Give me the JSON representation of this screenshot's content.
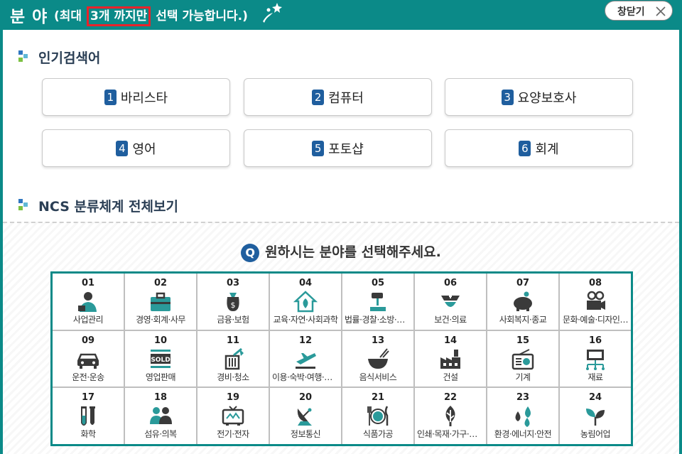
{
  "header": {
    "title": "분 야",
    "subtitle_before": "(최대",
    "subtitle_highlight": "3개 까지만",
    "subtitle_after": "선택 가능합니다.)",
    "close_label": "창닫기"
  },
  "popular": {
    "title": "인기검색어",
    "items": [
      {
        "num": "1",
        "label": "바리스타"
      },
      {
        "num": "2",
        "label": "컴퓨터"
      },
      {
        "num": "3",
        "label": "요양보호사"
      },
      {
        "num": "4",
        "label": "영어"
      },
      {
        "num": "5",
        "label": "포토샵"
      },
      {
        "num": "6",
        "label": "회계"
      }
    ]
  },
  "ncs": {
    "title": "NCS 분류체계 전체보기",
    "question_icon": "Q",
    "question": "원하시는 분야를 선택해주세요.",
    "categories": [
      {
        "num": "01",
        "label": "사업관리",
        "icon": "manager-icon"
      },
      {
        "num": "02",
        "label": "경영·회계·사무",
        "icon": "briefcase-icon"
      },
      {
        "num": "03",
        "label": "금융·보험",
        "icon": "money-bag-icon"
      },
      {
        "num": "04",
        "label": "교육·자연·사회과학",
        "icon": "house-leaf-icon"
      },
      {
        "num": "05",
        "label": "법률·경찰·소방·교…",
        "icon": "gavel-icon"
      },
      {
        "num": "06",
        "label": "보건·의료",
        "icon": "nurse-icon"
      },
      {
        "num": "07",
        "label": "사회복지·종교",
        "icon": "piggy-bank-icon"
      },
      {
        "num": "08",
        "label": "문화·예술·디자인…",
        "icon": "camera-icon"
      },
      {
        "num": "09",
        "label": "운전·운송",
        "icon": "car-icon"
      },
      {
        "num": "10",
        "label": "영업판매",
        "icon": "sold-sign-icon",
        "icon_text": "SOLD"
      },
      {
        "num": "11",
        "label": "경비·청소",
        "icon": "trash-bin-icon"
      },
      {
        "num": "12",
        "label": "이용·숙박·여행·오…",
        "icon": "airplane-icon"
      },
      {
        "num": "13",
        "label": "음식서비스",
        "icon": "bowl-icon"
      },
      {
        "num": "14",
        "label": "건설",
        "icon": "factory-icon"
      },
      {
        "num": "15",
        "label": "기계",
        "icon": "radio-icon"
      },
      {
        "num": "16",
        "label": "재료",
        "icon": "monitor-network-icon"
      },
      {
        "num": "17",
        "label": "화학",
        "icon": "test-tube-icon"
      },
      {
        "num": "18",
        "label": "섬유·의복",
        "icon": "people-icon"
      },
      {
        "num": "19",
        "label": "전기·전자",
        "icon": "tv-icon"
      },
      {
        "num": "20",
        "label": "정보통신",
        "icon": "satellite-dish-icon"
      },
      {
        "num": "21",
        "label": "식품가공",
        "icon": "plate-cutlery-icon"
      },
      {
        "num": "22",
        "label": "인쇄·목재·가구·공…",
        "icon": "tree-icon"
      },
      {
        "num": "23",
        "label": "환경·에너지·안전",
        "icon": "water-drop-icon"
      },
      {
        "num": "24",
        "label": "농림어업",
        "icon": "sprout-icon"
      }
    ]
  },
  "colors": {
    "teal": "#0b8a88",
    "blue": "#1f5e9e",
    "highlight_red": "#e8232a",
    "icon_teal": "#2a9a9a",
    "icon_dark": "#3a3a3a"
  }
}
